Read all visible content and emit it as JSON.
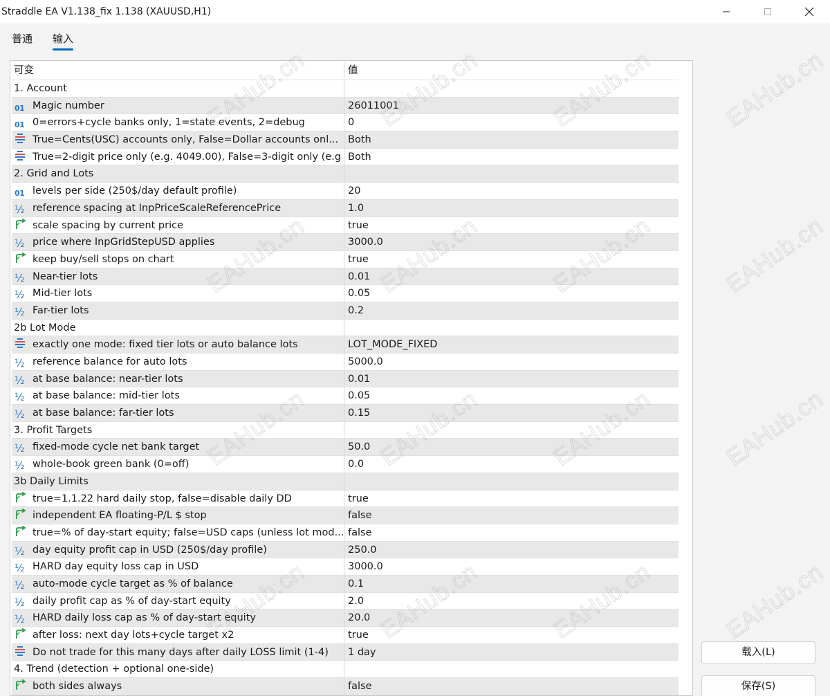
{
  "window": {
    "title": "Straddle EA V1.138_fix 1.138 (XAUUSD,H1)"
  },
  "tabs": [
    {
      "label": "普通",
      "active": false
    },
    {
      "label": "输入",
      "active": true
    }
  ],
  "grid": {
    "header": {
      "name": "可变",
      "value": "值"
    },
    "rows": [
      {
        "type": "group",
        "name": "1. Account",
        "value": ""
      },
      {
        "type": "param",
        "icon": "int",
        "name": "Magic number",
        "value": "26011001"
      },
      {
        "type": "param",
        "icon": "int",
        "name": "0=errors+cycle banks only, 1=state events, 2=debug",
        "value": "0"
      },
      {
        "type": "param",
        "icon": "enum",
        "name": "True=Cents(USC) accounts only, False=Dollar accounts onl...",
        "value": "Both"
      },
      {
        "type": "param",
        "icon": "enum",
        "name": "True=2-digit price only (e.g. 4049.00), False=3-digit only (e.g",
        "value": "Both"
      },
      {
        "type": "group",
        "name": "2. Grid and Lots",
        "value": ""
      },
      {
        "type": "param",
        "icon": "int",
        "name": "levels per side (250$/day default profile)",
        "value": "20"
      },
      {
        "type": "param",
        "icon": "double",
        "name": "reference spacing at InpPriceScaleReferencePrice",
        "value": "1.0"
      },
      {
        "type": "param",
        "icon": "bool",
        "name": "scale spacing by current price",
        "value": "true"
      },
      {
        "type": "param",
        "icon": "double",
        "name": "price where InpGridStepUSD applies",
        "value": "3000.0"
      },
      {
        "type": "param",
        "icon": "bool",
        "name": "keep buy/sell stops on chart",
        "value": "true"
      },
      {
        "type": "param",
        "icon": "double",
        "name": "Near-tier lots",
        "value": "0.01"
      },
      {
        "type": "param",
        "icon": "double",
        "name": "Mid-tier lots",
        "value": "0.05"
      },
      {
        "type": "param",
        "icon": "double",
        "name": "Far-tier lots",
        "value": "0.2"
      },
      {
        "type": "group",
        "name": "2b Lot Mode",
        "value": ""
      },
      {
        "type": "param",
        "icon": "enum",
        "name": "exactly one mode: fixed tier lots or auto balance lots",
        "value": "LOT_MODE_FIXED"
      },
      {
        "type": "param",
        "icon": "double",
        "name": "reference balance for auto lots",
        "value": "5000.0"
      },
      {
        "type": "param",
        "icon": "double",
        "name": "at base balance: near-tier lots",
        "value": "0.01"
      },
      {
        "type": "param",
        "icon": "double",
        "name": "at base balance: mid-tier lots",
        "value": "0.05"
      },
      {
        "type": "param",
        "icon": "double",
        "name": "at base balance: far-tier lots",
        "value": "0.15"
      },
      {
        "type": "group",
        "name": "3. Profit Targets",
        "value": ""
      },
      {
        "type": "param",
        "icon": "double",
        "name": "fixed-mode cycle net bank target",
        "value": "50.0"
      },
      {
        "type": "param",
        "icon": "double",
        "name": "whole-book green bank (0=off)",
        "value": "0.0"
      },
      {
        "type": "group",
        "name": "3b Daily Limits",
        "value": ""
      },
      {
        "type": "param",
        "icon": "bool",
        "name": "true=1.1.22 hard daily stop, false=disable daily DD",
        "value": "true"
      },
      {
        "type": "param",
        "icon": "bool",
        "name": "independent EA floating-P/L $ stop",
        "value": "false"
      },
      {
        "type": "param",
        "icon": "bool",
        "name": "true=% of day-start equity; false=USD caps (unless lot mod...",
        "value": "false"
      },
      {
        "type": "param",
        "icon": "double",
        "name": "day equity profit cap in USD (250$/day profile)",
        "value": "250.0"
      },
      {
        "type": "param",
        "icon": "double",
        "name": "HARD day equity loss cap in USD",
        "value": "3000.0"
      },
      {
        "type": "param",
        "icon": "double",
        "name": "auto-mode cycle target as % of balance",
        "value": "0.1"
      },
      {
        "type": "param",
        "icon": "double",
        "name": "daily profit cap as % of day-start equity",
        "value": "2.0"
      },
      {
        "type": "param",
        "icon": "double",
        "name": "HARD daily loss cap as % of day-start equity",
        "value": "20.0"
      },
      {
        "type": "param",
        "icon": "bool",
        "name": "after loss: next day lots+cycle target x2",
        "value": "true"
      },
      {
        "type": "param",
        "icon": "enum",
        "name": "Do not trade for this many days after daily LOSS limit (1-4)",
        "value": "1 day"
      },
      {
        "type": "group",
        "name": "4. Trend (detection + optional one-side)",
        "value": ""
      },
      {
        "type": "param",
        "icon": "bool",
        "name": "both sides always",
        "value": "false"
      }
    ]
  },
  "buttons": {
    "load": "载入(L)",
    "save": "保存(S)"
  },
  "watermark": "EAHub.cn",
  "colors": {
    "accent": "#0067c0",
    "icon_blue": "#2b78c8",
    "icon_green": "#2e9a4e",
    "row_alt": "#e8e8e8"
  }
}
